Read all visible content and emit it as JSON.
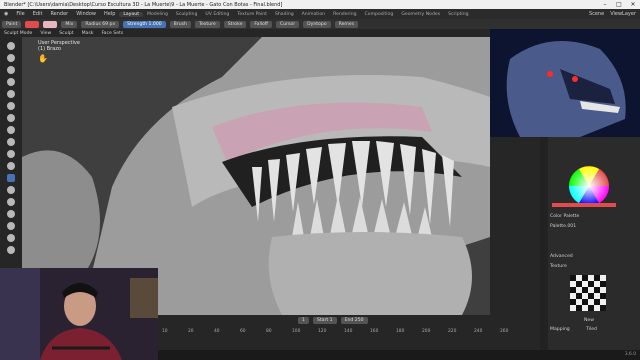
{
  "window": {
    "title": "Blender* [C:\\Users\\damia\\Desktop\\Curso Escultura 3D - La Muerte\\9 - La Muerte - Gato Con Botas - Final.blend]",
    "controls": [
      "–",
      "□",
      "✕"
    ]
  },
  "menu": {
    "items": [
      "File",
      "Edit",
      "Render",
      "Window",
      "Help"
    ],
    "workspaces": [
      "Layout",
      "Modeling",
      "Sculpting",
      "UV Editing",
      "Texture Paint",
      "Shading",
      "Animation",
      "Rendering",
      "Compositing",
      "Geometry Nodes",
      "Scripting"
    ],
    "active_workspace": "Layout",
    "scene": "Scene",
    "view_layer": "ViewLayer"
  },
  "tool_header": {
    "brush_name": "Paint",
    "blend": "Mix",
    "radius_label": "Radius",
    "radius_value": "69 px",
    "strength_label": "Strength",
    "strength_value": "1.000",
    "menus": [
      "Brush",
      "Texture",
      "Stroke",
      "Falloff",
      "Cursor"
    ],
    "dyntopo": "Dyntopo",
    "remesh": "Remes",
    "colors": {
      "primary": "#e24b4b",
      "secondary": "#e7b7c0"
    }
  },
  "mode_header": {
    "mode": "Sculpt Mode",
    "items": [
      "View",
      "Sculpt",
      "Mask",
      "Face Sets"
    ]
  },
  "viewport": {
    "line1": "User Perspective",
    "line2": "(1) Brazo"
  },
  "properties": {
    "color_palette_label": "Color Palette",
    "palette_name": "Palette.001",
    "advanced_label": "Advanced",
    "texture_label": "Texture",
    "new_label": "New",
    "mapping_label": "Mapping",
    "mapping_value": "Tiled"
  },
  "timeline": {
    "current_frame": "1",
    "start_label": "Start",
    "start_value": "1",
    "end_label": "End",
    "end_value": "250",
    "ticks": [
      "10",
      "20",
      "40",
      "60",
      "80",
      "100",
      "120",
      "140",
      "160",
      "180",
      "200",
      "220",
      "240",
      "260"
    ]
  },
  "status": {
    "version": "3.6.0"
  },
  "icons": [
    "blender-logo-icon",
    "camera-icon",
    "brush-icon",
    "hand-icon"
  ]
}
